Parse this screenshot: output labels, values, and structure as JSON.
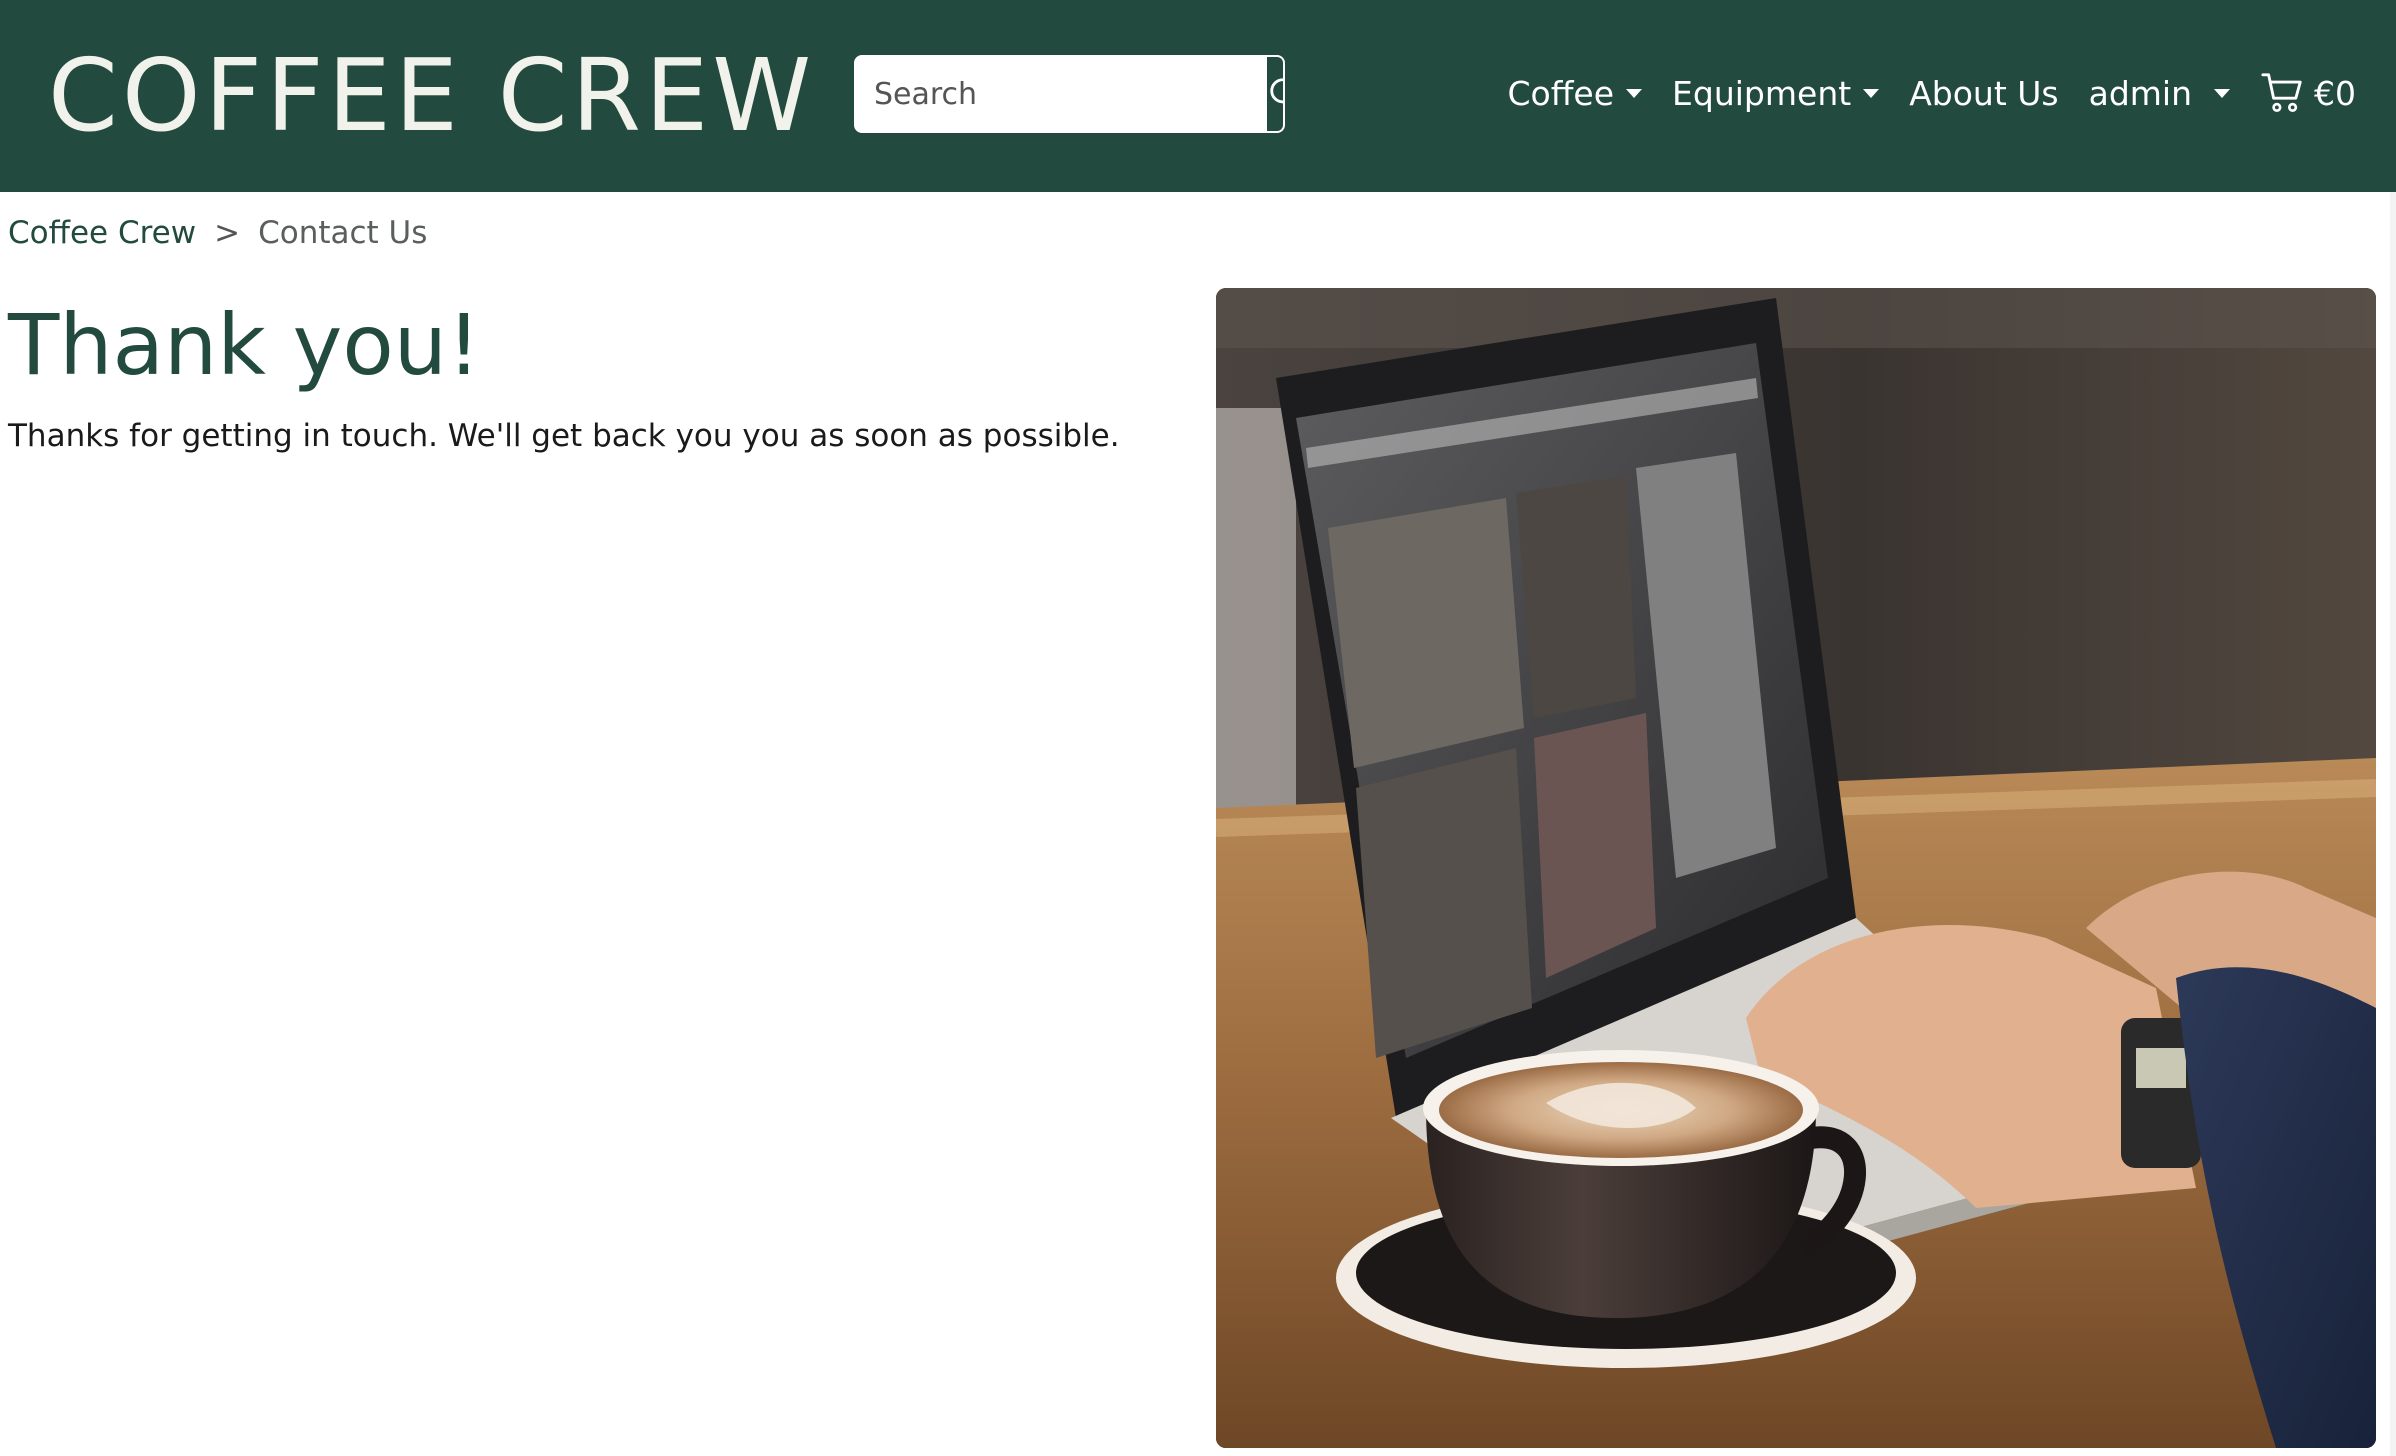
{
  "header": {
    "brand": "COFFEE CREW",
    "search_placeholder": "Search",
    "search_icon": "search-icon",
    "nav": {
      "coffee": "Coffee",
      "equipment": "Equipment",
      "about": "About Us",
      "user": "admin",
      "cart_total": "€0",
      "cart_icon": "shopping-cart-icon"
    }
  },
  "breadcrumb": {
    "home": "Coffee Crew",
    "separator": ">",
    "current": "Contact Us"
  },
  "main": {
    "title": "Thank you!",
    "message": "Thanks for getting in touch. We'll get back you you as soon as possible."
  },
  "colors": {
    "brand_green": "#234a3e",
    "text_light": "#f2f2ec"
  }
}
